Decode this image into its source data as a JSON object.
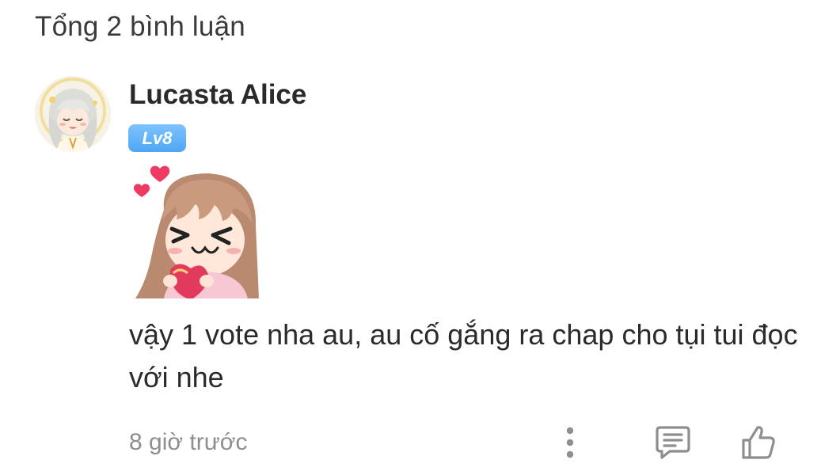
{
  "header": {
    "total_comments": "Tổng 2 bình luận"
  },
  "comment": {
    "username": "Lucasta Alice",
    "level": "Lv8",
    "text": "vậy 1 vote nha au, au cố gắng ra chap cho tụi tui đọc với nhe",
    "timestamp": "8 giờ trước",
    "icons": {
      "more": "more-vertical-icon",
      "reply": "reply-comment-icon",
      "like": "thumbs-up-icon"
    }
  },
  "colors": {
    "level_badge": "#5aaef7",
    "icon_gray": "#8e8e8e",
    "text": "#2b2b2b"
  }
}
